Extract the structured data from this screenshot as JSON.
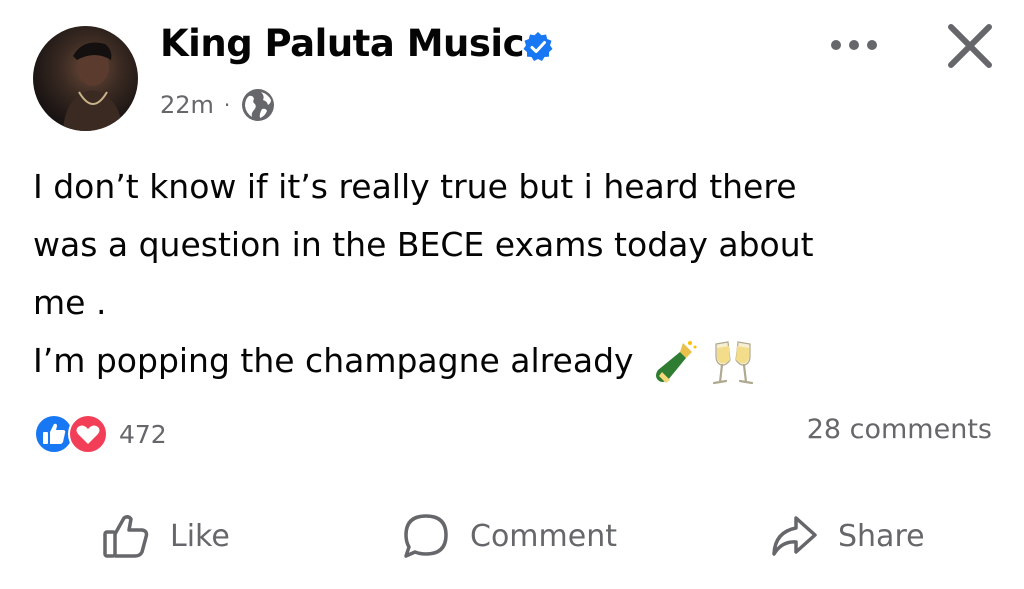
{
  "post": {
    "author": "King Paluta Music",
    "time": "22m",
    "separator": "·",
    "lines": [
      "I don’t know if it’s really true but i heard there",
      "was a question in the BECE exams today about",
      "me .",
      "I’m popping the champagne already"
    ],
    "emojis": [
      "champagne-bottle",
      "clinking-glasses"
    ],
    "reaction_count": "472",
    "comments_count": "28 comments"
  },
  "actions": {
    "like_label": "Like",
    "comment_label": "Comment",
    "share_label": "Share"
  },
  "colors": {
    "text": "#050505",
    "secondary_text": "#65676b",
    "verified_badge": "#1877f2",
    "like_reaction": "#1877f2",
    "love_reaction": "#f33e58"
  },
  "icons": {
    "avatar": "profile-photo",
    "audience": "globe-icon",
    "menu": "more-icon",
    "close": "close-icon",
    "like": "thumbs-up-icon",
    "comment": "comment-bubble-icon",
    "share": "share-arrow-icon"
  }
}
